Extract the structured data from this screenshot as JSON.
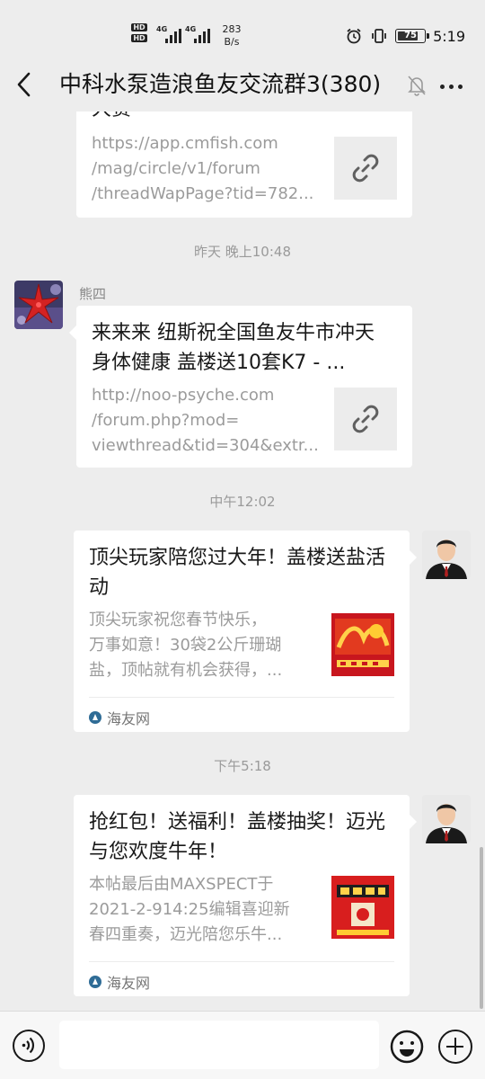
{
  "status_bar": {
    "hd1": "HD",
    "hd2": "HD",
    "net1": "4G",
    "net2": "4G",
    "speed_value": "283",
    "speed_unit": "B/s",
    "battery": "75",
    "time": "5:19"
  },
  "header": {
    "title": "中科水泵造浪鱼友交流群3(380)"
  },
  "messages": {
    "msg1": {
      "title_fragment": "大赛",
      "desc_lines": [
        "https://app.cmfish.com",
        "/mag/circle/v1/forum",
        "/threadWapPage?tid=782..."
      ]
    },
    "time1": "昨天 晚上10:48",
    "msg2": {
      "sender": "熊四",
      "title": "来来来 纽斯祝全国鱼友牛市冲天 身体健康 盖楼送10套K7 - ...",
      "desc_lines": [
        "http://noo-psyche.com",
        "/forum.php?mod=",
        "viewthread&tid=304&extr..."
      ]
    },
    "time2": "中午12:02",
    "msg3": {
      "title": "顶尖玩家陪您过大年！盖楼送盐活动",
      "desc_lines": [
        "顶尖玩家祝您春节快乐，",
        "万事如意！30袋2公斤珊瑚",
        "盐，顶帖就有机会获得，..."
      ],
      "source": "海友网"
    },
    "time3": "下午5:18",
    "msg4": {
      "title": "抢红包！送福利！盖楼抽奖！迈光与您欢度牛年！",
      "desc_lines": [
        "本帖最后由MAXSPECT于",
        "2021-2-914:25编辑喜迎新",
        "春四重奏，迈光陪您乐牛..."
      ],
      "source": "海友网"
    }
  },
  "input_bar": {
    "value": ""
  }
}
